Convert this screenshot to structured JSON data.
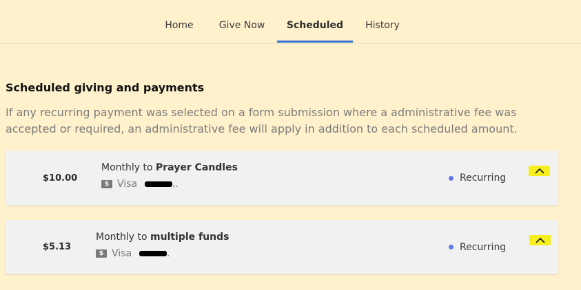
{
  "nav": {
    "tabs": [
      {
        "label": "Home"
      },
      {
        "label": "Give Now"
      },
      {
        "label": "Scheduled"
      },
      {
        "label": "History"
      }
    ],
    "active": "Scheduled"
  },
  "section": {
    "title": "Scheduled giving and payments",
    "note": "If any recurring payment was selected on a form submission where a administrative fee was accepted or required, an administrative fee will apply in addition to each scheduled amount."
  },
  "payments": [
    {
      "amount": "$10.00",
      "frequency_text": "Monthly to",
      "fund": "Prayer Candles",
      "method": "Visa",
      "tail": "..",
      "status": "Recurring"
    },
    {
      "amount": "$5.13",
      "frequency_text": "Monthly to",
      "fund": "multiple funds",
      "method": "Visa",
      "tail": ".",
      "status": "Recurring"
    }
  ],
  "colors": {
    "page_bg": "#fff1cc",
    "card_bg": "#f1f1f1",
    "active_tab_underline": "#2f6fd6",
    "status_dot": "#6178e6",
    "chevron_highlight": "#f7ef1c"
  },
  "icons": {
    "payment_method": "dollar-card-icon",
    "expand_toggle": "chevron-up-icon",
    "status": "status-dot-icon"
  }
}
